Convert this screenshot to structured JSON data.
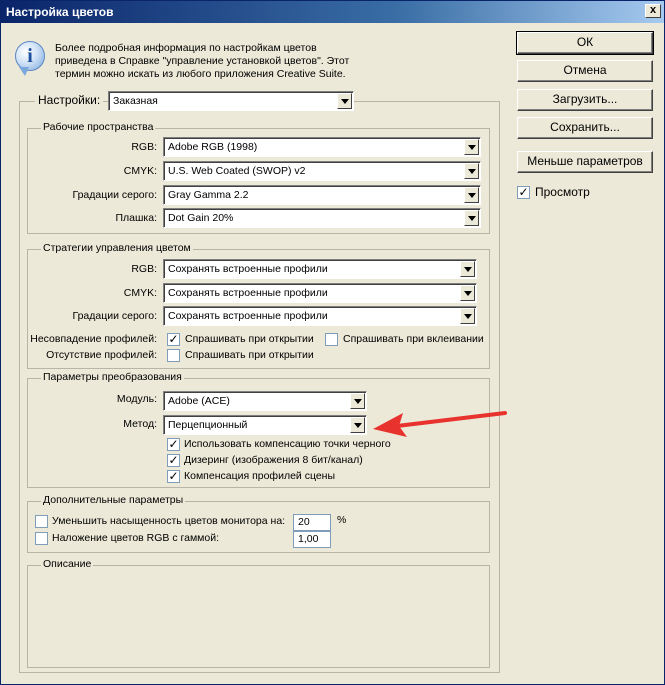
{
  "window": {
    "title": "Настройка цветов",
    "close_glyph": "x"
  },
  "info": {
    "icon": "info-icon",
    "text": "Более подробная информация по настройкам цветов\nприведена в Справке \"управление установкой цветов\". Этот\nтермин можно искать из любого приложения Creative Suite."
  },
  "buttons": {
    "ok": "ОК",
    "cancel": "Отмена",
    "load": "Загрузить...",
    "save": "Сохранить...",
    "fewer": "Меньше параметров"
  },
  "preview": {
    "label": "Просмотр",
    "checked": true
  },
  "settings": {
    "label": "Настройки:",
    "value": "Заказная"
  },
  "workspaces": {
    "title": "Рабочие пространства",
    "rgb": {
      "label": "RGB:",
      "value": "Adobe RGB (1998)"
    },
    "cmyk": {
      "label": "CMYK:",
      "value": "U.S. Web Coated (SWOP) v2"
    },
    "gray": {
      "label": "Градации серого:",
      "value": "Gray Gamma 2.2"
    },
    "spot": {
      "label": "Плашка:",
      "value": "Dot Gain 20%"
    }
  },
  "policies": {
    "title": "Стратегии управления цветом",
    "rgb": {
      "label": "RGB:",
      "value": "Сохранять встроенные профили"
    },
    "cmyk": {
      "label": "CMYK:",
      "value": "Сохранять встроенные профили"
    },
    "gray": {
      "label": "Градации серого:",
      "value": "Сохранять встроенные профили"
    },
    "mismatch_label": "Несовпадение профилей:",
    "ask_open": {
      "label": "Спрашивать при открытии",
      "checked": true
    },
    "ask_paste": {
      "label": "Спрашивать при вклеивании",
      "checked": false
    },
    "missing_label": "Отсутствие профилей:",
    "missing_ask_open": {
      "label": "Спрашивать при открытии",
      "checked": false
    }
  },
  "conversion": {
    "title": "Параметры преобразования",
    "engine": {
      "label": "Модуль:",
      "value": "Adobe (ACE)"
    },
    "intent": {
      "label": "Метод:",
      "value": "Перцепционный"
    },
    "bpc": {
      "label": "Использовать компенсацию точки черного",
      "checked": true
    },
    "dither": {
      "label": "Дизеринг (изображения 8 бит/канал)",
      "checked": true
    },
    "scene": {
      "label": "Компенсация профилей сцены",
      "checked": true
    }
  },
  "advanced": {
    "title": "Дополнительные параметры",
    "desaturate": {
      "label": "Уменьшить насыщенность цветов монитора на:",
      "checked": false,
      "value": "20",
      "unit": "%"
    },
    "blend": {
      "label": "Наложение цветов RGB с гаммой:",
      "checked": false,
      "value": "1,00"
    }
  },
  "description": {
    "title": "Описание"
  },
  "annotation": {
    "arrow_color": "#e8322e"
  },
  "colors": {
    "title_start": "#0a246a",
    "title_end": "#a6caf0",
    "dialog_bg": "#ece9d8"
  }
}
